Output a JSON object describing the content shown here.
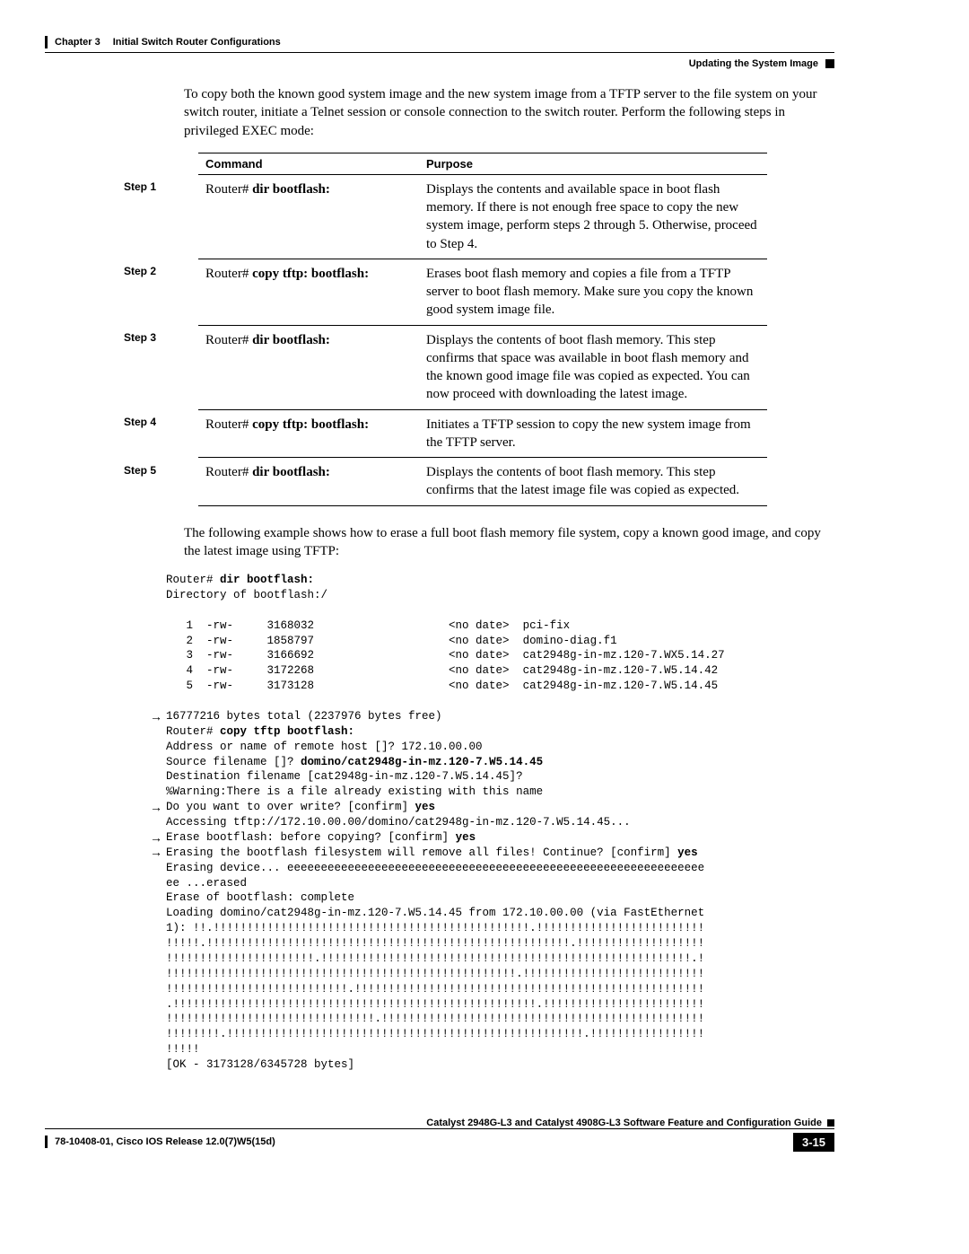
{
  "header": {
    "chapter_label": "Chapter 3",
    "chapter_title": "Initial Switch Router Configurations",
    "section_title": "Updating the System Image"
  },
  "intro_para": "To copy both the known good system image and the new system image from a TFTP server to the file system on your switch router, initiate a Telnet session or console connection to the switch router. Perform the following steps in privileged EXEC mode:",
  "table": {
    "head_command": "Command",
    "head_purpose": "Purpose",
    "rows": [
      {
        "step": "Step 1",
        "cmd_prefix": "Router# ",
        "cmd_bold": "dir bootflash:",
        "purpose": "Displays the contents and available space in boot flash memory. If there is not enough free space to copy the new system image, perform steps 2 through 5. Otherwise, proceed to Step 4."
      },
      {
        "step": "Step 2",
        "cmd_prefix": "Router# ",
        "cmd_bold": "copy tftp: bootflash:",
        "purpose": "Erases boot flash memory and copies a file from a TFTP server to boot flash memory. Make sure you copy the known good system image file."
      },
      {
        "step": "Step 3",
        "cmd_prefix": "Router# ",
        "cmd_bold": "dir bootflash:",
        "purpose": "Displays the contents of boot flash memory. This step confirms that space was available in boot flash memory and the known good image file was copied as expected. You can now proceed with downloading the latest image."
      },
      {
        "step": "Step 4",
        "cmd_prefix": "Router# ",
        "cmd_bold": "copy tftp: bootflash:",
        "purpose": "Initiates a TFTP session to copy the new system image from the TFTP server."
      },
      {
        "step": "Step 5",
        "cmd_prefix": "Router# ",
        "cmd_bold": "dir bootflash:",
        "purpose": "Displays the contents of boot flash memory. This step confirms that the latest image file was copied as expected."
      }
    ]
  },
  "mid_para": "The following example shows how to erase a full boot flash memory file system, copy a known good image, and copy the latest image using TFTP:",
  "console": {
    "line01_pre": "Router# ",
    "line01_b": "dir bootflash:",
    "line02": "Directory of bootflash:/",
    "line03": "",
    "line04": "   1  -rw-     3168032                    <no date>  pci-fix",
    "line05": "   2  -rw-     1858797                    <no date>  domino-diag.f1",
    "line06": "   3  -rw-     3166692                    <no date>  cat2948g-in-mz.120-7.WX5.14.27",
    "line07": "   4  -rw-     3172268                    <no date>  cat2948g-in-mz.120-7.W5.14.42",
    "line08": "   5  -rw-     3173128                    <no date>  cat2948g-in-mz.120-7.W5.14.45",
    "line09": "",
    "line10": "16777216 bytes total (2237976 bytes free)",
    "line11_pre": "Router# ",
    "line11_b": "copy tftp bootflash:",
    "line12": "Address or name of remote host []? 172.10.00.00",
    "line13_pre": "Source filename []? ",
    "line13_b": "domino/cat2948g-in-mz.120-7.W5.14.45",
    "line14": "Destination filename [cat2948g-in-mz.120-7.W5.14.45]?",
    "line15": "%Warning:There is a file already existing with this name",
    "line16_pre": "Do you want to over write? [confirm] ",
    "line16_b": "yes",
    "line17": "Accessing tftp://172.10.00.00/domino/cat2948g-in-mz.120-7.W5.14.45...",
    "line18_pre": "Erase bootflash: before copying? [confirm] ",
    "line18_b": "yes",
    "line19_pre": "Erasing the bootflash filesystem will remove all files! Continue? [confirm] ",
    "line19_b": "yes",
    "line20": "Erasing device... eeeeeeeeeeeeeeeeeeeeeeeeeeeeeeeeeeeeeeeeeeeeeeeeeeeeeeeeeeeeee",
    "line21": "ee ...erased",
    "line22": "Erase of bootflash: complete",
    "line23": "Loading domino/cat2948g-in-mz.120-7.W5.14.45 from 172.10.00.00 (via FastEthernet",
    "line24": "1): !!.!!!!!!!!!!!!!!!!!!!!!!!!!!!!!!!!!!!!!!!!!!!!!!!.!!!!!!!!!!!!!!!!!!!!!!!!!",
    "line25": "!!!!!.!!!!!!!!!!!!!!!!!!!!!!!!!!!!!!!!!!!!!!!!!!!!!!!!!!!!!!.!!!!!!!!!!!!!!!!!!!",
    "line26": "!!!!!!!!!!!!!!!!!!!!!!.!!!!!!!!!!!!!!!!!!!!!!!!!!!!!!!!!!!!!!!!!!!!!!!!!!!!!!!.!",
    "line27": "!!!!!!!!!!!!!!!!!!!!!!!!!!!!!!!!!!!!!!!!!!!!!!!!!!!!.!!!!!!!!!!!!!!!!!!!!!!!!!!!",
    "line28": "!!!!!!!!!!!!!!!!!!!!!!!!!!!.!!!!!!!!!!!!!!!!!!!!!!!!!!!!!!!!!!!!!!!!!!!!!!!!!!!!",
    "line29": ".!!!!!!!!!!!!!!!!!!!!!!!!!!!!!!!!!!!!!!!!!!!!!!!!!!!!!!.!!!!!!!!!!!!!!!!!!!!!!!!",
    "line30": "!!!!!!!!!!!!!!!!!!!!!!!!!!!!!!!.!!!!!!!!!!!!!!!!!!!!!!!!!!!!!!!!!!!!!!!!!!!!!!!!",
    "line31": "!!!!!!!!.!!!!!!!!!!!!!!!!!!!!!!!!!!!!!!!!!!!!!!!!!!!!!!!!!!!!!.!!!!!!!!!!!!!!!!!",
    "line32": "!!!!!",
    "line33": "[OK - 3173128/6345728 bytes]"
  },
  "footer": {
    "guide_title": "Catalyst 2948G-L3 and Catalyst 4908G-L3 Software Feature and Configuration Guide",
    "release": "78-10408-01, Cisco IOS Release 12.0(7)W5(15d)",
    "page": "3-15"
  }
}
